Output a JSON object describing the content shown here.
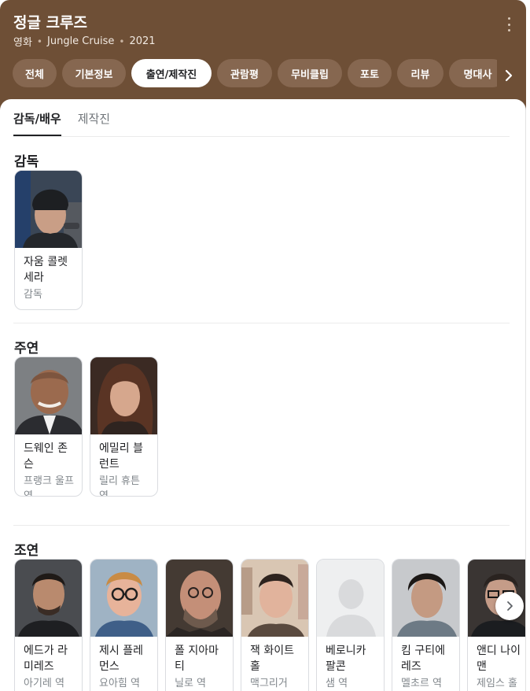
{
  "header": {
    "title": "정글 크루즈",
    "meta": [
      "영화",
      "Jungle Cruise",
      "2021"
    ],
    "background": "#6e4f36"
  },
  "tabs": [
    {
      "label": "전체",
      "active": false
    },
    {
      "label": "기본정보",
      "active": false
    },
    {
      "label": "출연/제작진",
      "active": true
    },
    {
      "label": "관람평",
      "active": false
    },
    {
      "label": "무비클립",
      "active": false
    },
    {
      "label": "포토",
      "active": false
    },
    {
      "label": "리뷰",
      "active": false
    },
    {
      "label": "명대사",
      "active": false
    }
  ],
  "subtabs": [
    {
      "label": "감독/배우",
      "active": true
    },
    {
      "label": "제작진",
      "active": false
    }
  ],
  "sections": {
    "director": {
      "title": "감독",
      "people": [
        {
          "name": "자움 콜렛 세라",
          "role": "감독"
        }
      ]
    },
    "lead": {
      "title": "주연",
      "people": [
        {
          "name": "드웨인 존슨",
          "role": "프랭크 울프 역"
        },
        {
          "name": "에밀리 블런트",
          "role": "릴리 휴튼 역"
        }
      ]
    },
    "supporting": {
      "title": "조연",
      "people": [
        {
          "name": "에드가 라미레즈",
          "role": "아기레 역"
        },
        {
          "name": "제시 플레먼스",
          "role": "요아힘 역"
        },
        {
          "name": "폴 지아마티",
          "role": "닐로 역"
        },
        {
          "name": "잭 화이트홀",
          "role": "맥그리거"
        },
        {
          "name": "베로니카 팔콘",
          "role": "샘 역"
        },
        {
          "name": "킴 구티에레즈",
          "role": "멜초르 역"
        },
        {
          "name": "앤디 나이맨",
          "role": "제임스 홀"
        }
      ]
    }
  },
  "icons": {
    "more": "more-vert-icon",
    "tabs_next": "chevron-right-icon",
    "row_next": "chevron-right-icon",
    "placeholder": "person-placeholder-icon"
  }
}
